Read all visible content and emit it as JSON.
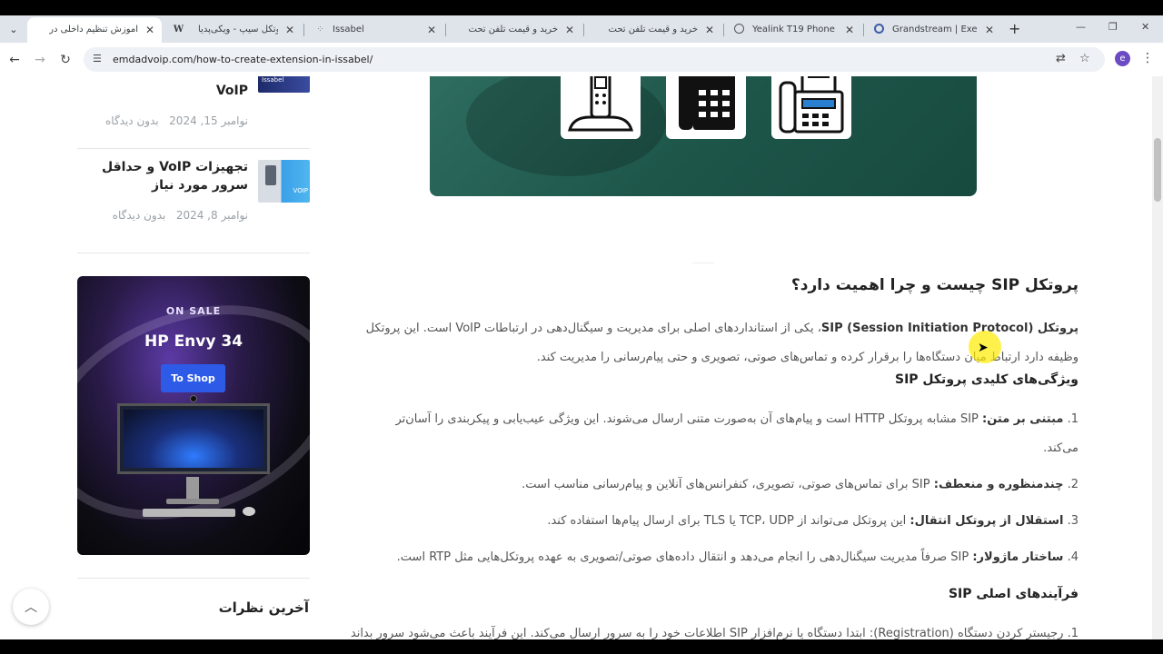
{
  "browser": {
    "tabs": [
      {
        "title": "آموزش تنظیم داخلی در",
        "active": true
      },
      {
        "title": "پروتکل سیپ - ویکی‌پدیا",
        "favicon": "W"
      },
      {
        "title": "Issabel"
      },
      {
        "title": "خرید و قیمت تلفن تحت"
      },
      {
        "title": "خرید و قیمت تلفن تحت"
      },
      {
        "title": "Yealink T19 Phone"
      },
      {
        "title": "Grandstream | Executi"
      }
    ],
    "url": "emdadvoip.com/how-to-create-extension-in-issabel/",
    "profile_initial": "e"
  },
  "sidebar": {
    "posts": [
      {
        "title": "VoIP",
        "date": "نوامبر 15, 2024",
        "comments": "بدون دیدگاه",
        "thumb_label": "Issabel"
      },
      {
        "title": "تجهیزات VoIP و حداقل سرور مورد نیاز",
        "date": "نوامبر 8, 2024",
        "comments": "بدون دیدگاه",
        "thumb_label": "VOIP"
      }
    ],
    "ad": {
      "badge": "ON SALE",
      "product": "HP Envy 34",
      "button": "To Shop"
    },
    "recent_comments_title": "آخرین نظرات"
  },
  "article": {
    "heading": "پروتکل SIP چیست و چرا اهمیت دارد؟",
    "intro_bold": "پروتکل (Session Initiation Protocol) SIP",
    "intro_rest": "، یکی از استانداردهای اصلی برای مدیریت و سیگنال‌دهی در ارتباطات VoIP است. این پروتکل وظیفه دارد ارتباط میان دستگاه‌ها را برقرار کرده و تماس‌های صوتی، تصویری و حتی پیام‌رسانی را مدیریت کند.",
    "features_heading": "ویژگی‌های کلیدی پروتکل SIP",
    "features": [
      {
        "num": "1.",
        "label": "مبتنی بر متن:",
        "text": " SIP مشابه پروتکل HTTP است و پیام‌های آن به‌صورت متنی ارسال می‌شوند. این ویژگی عیب‌یابی و پیکربندی را آسان‌تر می‌کند."
      },
      {
        "num": "2.",
        "label": "چندمنظوره و منعطف:",
        "text": " SIP برای تماس‌های صوتی، تصویری، کنفرانس‌های آنلاین و پیام‌رسانی مناسب است."
      },
      {
        "num": "3.",
        "label": "استقلال از پروتکل انتقال:",
        "text": " این پروتکل می‌تواند از TCP، UDP یا TLS برای ارسال پیام‌ها استفاده کند."
      },
      {
        "num": "4.",
        "label": "ساختار ماژولار:",
        "text": " SIP صرفاً مدیریت سیگنال‌دهی را انجام می‌دهد و انتقال داده‌های صوتی/تصویری به عهده پروتکل‌هایی مثل RTP است."
      }
    ],
    "processes_heading": "فرآیندهای اصلی SIP",
    "partial_line": "1. رجیستر کردن دستگاه (Registration): ابتدا دستگاه یا نرم‌افزار SIP اطلاعات خود را به سرور ارسال می‌کند. این فرآیند باعث می‌شود سرور بداند"
  },
  "icons": {
    "tab_menu": "chevron-down-icon",
    "back": "back-arrow-icon",
    "forward": "forward-arrow-icon",
    "reload": "reload-icon",
    "site_info": "tune-icon",
    "translate": "translate-icon",
    "bookmark": "star-icon",
    "menu": "kebab-icon",
    "scroll_top": "chevron-up-icon"
  }
}
